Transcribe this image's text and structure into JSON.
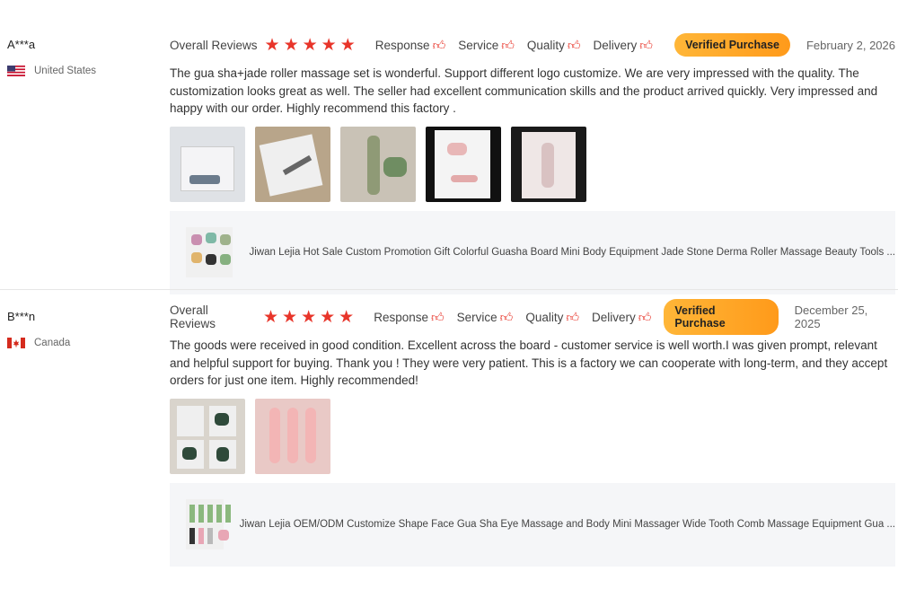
{
  "reviews": [
    {
      "reviewer": "A***a",
      "country": "United States",
      "flag_icon": "us-flag-icon",
      "overall_label": "Overall Reviews",
      "stars": 5,
      "tags": [
        "Response",
        "Service",
        "Quality",
        "Delivery"
      ],
      "verified": "Verified Purchase",
      "date": "February 2, 2026",
      "text": "The gua sha+jade roller massage set is wonderful. Support different logo customize. We are very impressed with the quality. The customization looks great as well. The seller had excellent communication skills and the product arrived quickly. Very impressed and happy with our order. Highly recommend this factory .",
      "photos": [
        "photo-box-icon",
        "photo-package-icon",
        "photo-gua-sha-icon",
        "photo-roller-card-icon",
        "photo-roller-tray-icon"
      ],
      "product_title": "Jiwan Lejia Hot Sale Custom Promotion Gift Colorful Guasha Board Mini Body Equipment Jade Stone Derma Roller Massage Beauty Tools ..."
    },
    {
      "reviewer": "B***n",
      "country": "Canada",
      "flag_icon": "canada-flag-icon",
      "overall_label": "Overall Reviews",
      "stars": 5,
      "tags": [
        "Response",
        "Service",
        "Quality",
        "Delivery"
      ],
      "verified": "Verified Purchase",
      "date": "December 25, 2025",
      "text": "The goods were received in good condition. Excellent across the board - customer service is well worth.I was given prompt, relevant and helpful support for buying. Thank you ! They were very patient. This is a factory we can cooperate with long-term, and they accept orders for just one item. Highly recommended!",
      "photos": [
        "photo-green-set-icon",
        "photo-pink-rollers-icon"
      ],
      "product_title": "Jiwan Lejia OEM/ODM Customize Shape Face Gua Sha Eye Massage and Body Mini Massager Wide Tooth Comb Massage Equipment Gua ..."
    }
  ],
  "colors": {
    "star": "#e8352a",
    "verified_bg": "#ffa52a",
    "product_bg": "#f5f6f8"
  }
}
